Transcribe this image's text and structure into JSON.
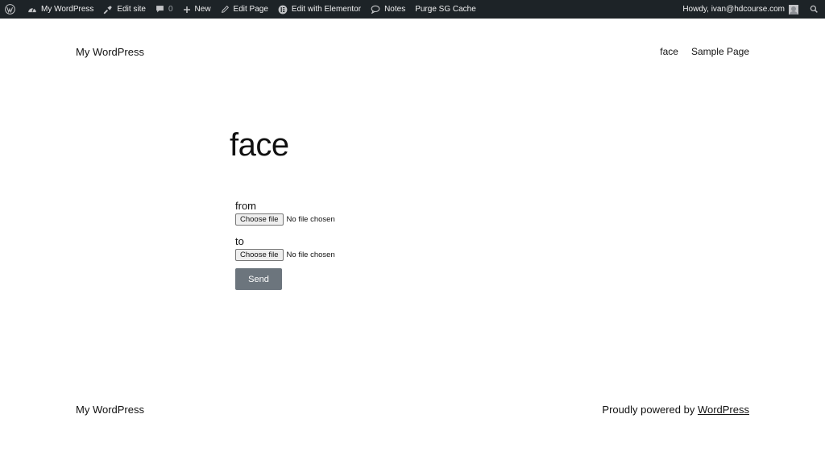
{
  "admin_bar": {
    "items": [
      {
        "label": "My WordPress",
        "icon": "dashboard-icon"
      },
      {
        "label": "Edit site",
        "icon": "brush-icon"
      },
      {
        "label": "0",
        "icon": "comment-icon"
      },
      {
        "label": "New",
        "icon": "plus-icon"
      },
      {
        "label": "Edit Page",
        "icon": "pencil-icon"
      },
      {
        "label": "Edit with Elementor",
        "icon": "elementor-icon"
      },
      {
        "label": "Notes",
        "icon": "speech-bubble-icon"
      },
      {
        "label": "Purge SG Cache",
        "icon": ""
      }
    ],
    "greeting": "Howdy, ivan@hdcourse.com"
  },
  "header": {
    "site_title": "My WordPress",
    "nav": [
      "face",
      "Sample Page"
    ]
  },
  "main": {
    "title": "face",
    "fields": [
      {
        "label": "from",
        "button": "Choose file",
        "status": "No file chosen"
      },
      {
        "label": "to",
        "button": "Choose file",
        "status": "No file chosen"
      }
    ],
    "submit_label": "Send"
  },
  "footer": {
    "site_title": "My WordPress",
    "credit_prefix": "Proudly powered by ",
    "credit_link": "WordPress"
  },
  "colors": {
    "admin_bar_bg": "#1d2327",
    "send_button_bg": "#6c757d"
  }
}
